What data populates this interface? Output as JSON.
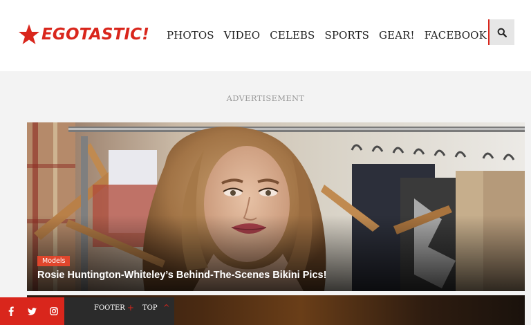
{
  "header": {
    "logo_text": "EGOTASTIC!",
    "nav": [
      "PHOTOS",
      "VIDEO",
      "CELEBS",
      "SPORTS",
      "GEAR!",
      "FACEBOOK!"
    ],
    "search_icon": "search-icon"
  },
  "advertisement_label": "ADVERTISEMENT",
  "hero": {
    "tag": "Models",
    "title": "Rosie Huntington-Whiteley’s Behind-The-Scenes Bikini Pics!"
  },
  "footer": {
    "social_icons": [
      "facebook-icon",
      "twitter-icon",
      "instagram-icon"
    ],
    "footer_label": "FOOTER",
    "footer_mark": "+",
    "top_label": "TOP",
    "top_mark": "^"
  },
  "colors": {
    "brand_red": "#d9261c",
    "tag_red": "#e0462c",
    "footer_dark": "#2b2b2b",
    "page_bg": "#f3f3f3"
  }
}
